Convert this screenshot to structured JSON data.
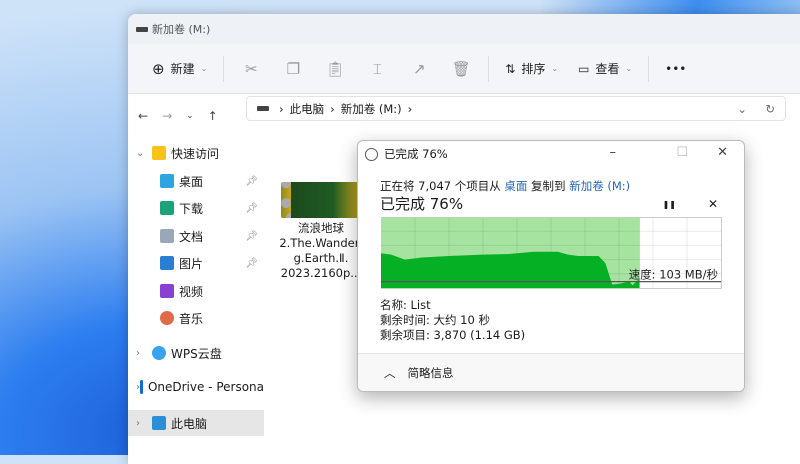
{
  "window": {
    "title": "新加卷 (M:)"
  },
  "toolbar": {
    "new_label": "新建",
    "sort_label": "排序",
    "view_label": "查看",
    "more_label": "•••"
  },
  "address": {
    "segments": [
      "此电脑",
      "新加卷 (M:)"
    ]
  },
  "sidebar": {
    "items": [
      {
        "label": "快速访问",
        "icon": "star-icon",
        "expand": true
      },
      {
        "label": "桌面",
        "icon": "desktop-icon",
        "pinned": true
      },
      {
        "label": "下载",
        "icon": "download-icon",
        "pinned": true
      },
      {
        "label": "文档",
        "icon": "document-icon",
        "pinned": true
      },
      {
        "label": "图片",
        "icon": "pictures-icon",
        "pinned": true
      },
      {
        "label": "视频",
        "icon": "video-icon"
      },
      {
        "label": "音乐",
        "icon": "music-icon"
      },
      {
        "label": "WPS云盘",
        "icon": "cloud-icon",
        "expand": true
      },
      {
        "label": "OneDrive - Persona",
        "icon": "onedrive-icon",
        "expand": true
      },
      {
        "label": "此电脑",
        "icon": "computer-icon",
        "expand": true,
        "selected": true
      }
    ]
  },
  "file": {
    "name_lines": [
      "流浪地球",
      "2.The.Wanderi",
      "g.Earth.Ⅱ.",
      "2023.2160p..."
    ]
  },
  "dialog": {
    "title": "已完成 76%",
    "copy_prefix": "正在将 7,047 个项目从",
    "source": "桌面",
    "copy_mid": "复制到",
    "dest": "新加卷 (M:)",
    "progress_label": "已完成 76%",
    "progress": 0.76,
    "speed_label": "速度: 103 MB/秒",
    "name_line": "名称: List",
    "time_line": "剩余时间: 大约 10 秒",
    "items_line": "剩余项目: 3,870 (1.14 GB)",
    "less_details": "简略信息",
    "pause": "❚❚",
    "cancel": "✕",
    "colors": {
      "progress": "#a6e3a0",
      "speed": "#06b025"
    },
    "speed_history": [
      [
        0,
        0.49
      ],
      [
        3,
        0.47
      ],
      [
        7,
        0.4
      ],
      [
        12,
        0.43
      ],
      [
        20,
        0.45
      ],
      [
        30,
        0.47
      ],
      [
        38,
        0.48
      ],
      [
        45,
        0.51
      ],
      [
        52,
        0.51
      ],
      [
        55,
        0.47
      ],
      [
        58,
        0.45
      ],
      [
        64,
        0.45
      ],
      [
        66,
        0.35
      ],
      [
        68,
        0.05
      ],
      [
        70,
        0.06
      ],
      [
        73,
        0.09
      ],
      [
        74,
        0.04
      ],
      [
        76,
        0.13
      ]
    ],
    "current_speed_level": 0.09
  }
}
